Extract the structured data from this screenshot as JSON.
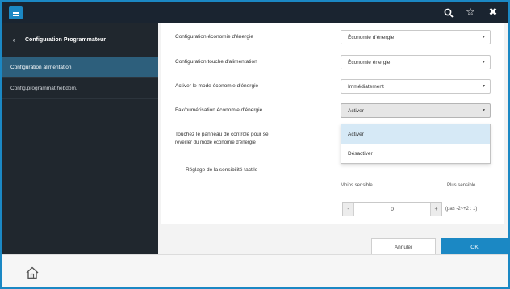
{
  "topbar": {
    "menu_icon": "menu-icon",
    "search_icon": "search-icon",
    "favorite_icon": "star-icon",
    "close_icon": "close-icon"
  },
  "sidebar": {
    "header": "Configuration Programmateur",
    "back_icon": "chevron-left-icon",
    "items": [
      {
        "label": "Configuration alimentation",
        "active": true
      },
      {
        "label": "Config.programmat.hebdom.",
        "active": false
      }
    ]
  },
  "settings": {
    "rows": [
      {
        "label": "Configuration économie d'énergie",
        "value": "Économie d'énergie"
      },
      {
        "label": "Configuration touche d'alimentation",
        "value": "Économie énergie"
      },
      {
        "label": "Activer le mode économie d'énergie",
        "value": "Immédiatement"
      },
      {
        "label": "Fax/numérisation économie d'énergie",
        "value": "Activer"
      }
    ],
    "dropdown_options": [
      "Activer",
      "Désactiver"
    ],
    "touch_wake_label_line1": "Touchez le panneau de contrôle pour se",
    "touch_wake_label_line2": "réveiller du mode économie d'énergie",
    "sensitivity_label": "Réglage de la sensibilité tactile",
    "less_sensitive": "Moins sensible",
    "more_sensitive": "Plus sensible",
    "stepper_minus": "-",
    "stepper_value": "0",
    "stepper_plus": "+",
    "stepper_range": "(pas -2~+2 : 1)"
  },
  "footer": {
    "cancel": "Annuler",
    "ok": "OK"
  },
  "bottombar": {
    "home_icon": "home-icon"
  },
  "colors": {
    "accent": "#1b88c4",
    "topbar": "#1a2430",
    "sidebar": "#20272e",
    "sidebar_active": "#2d5f7c"
  }
}
